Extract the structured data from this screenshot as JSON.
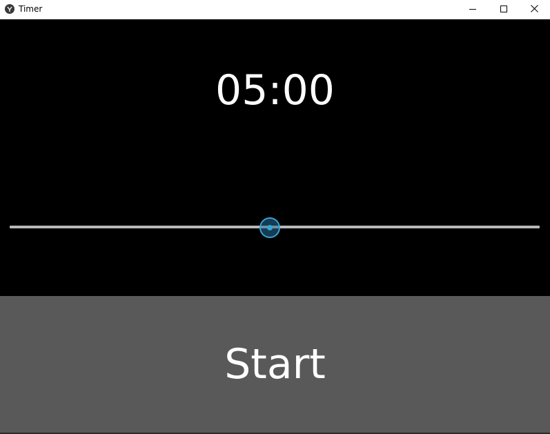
{
  "window": {
    "title": "Timer",
    "icon": "kivy-app-icon",
    "controls": {
      "minimize": "minimize-icon",
      "maximize": "maximize-icon",
      "close": "close-icon"
    }
  },
  "timer": {
    "display": "05:00"
  },
  "slider": {
    "value_fraction": 0.49,
    "accent_color": "#33a5d8",
    "track_color": "#b8b8b8"
  },
  "start_button": {
    "label": "Start",
    "background": "#595959"
  }
}
